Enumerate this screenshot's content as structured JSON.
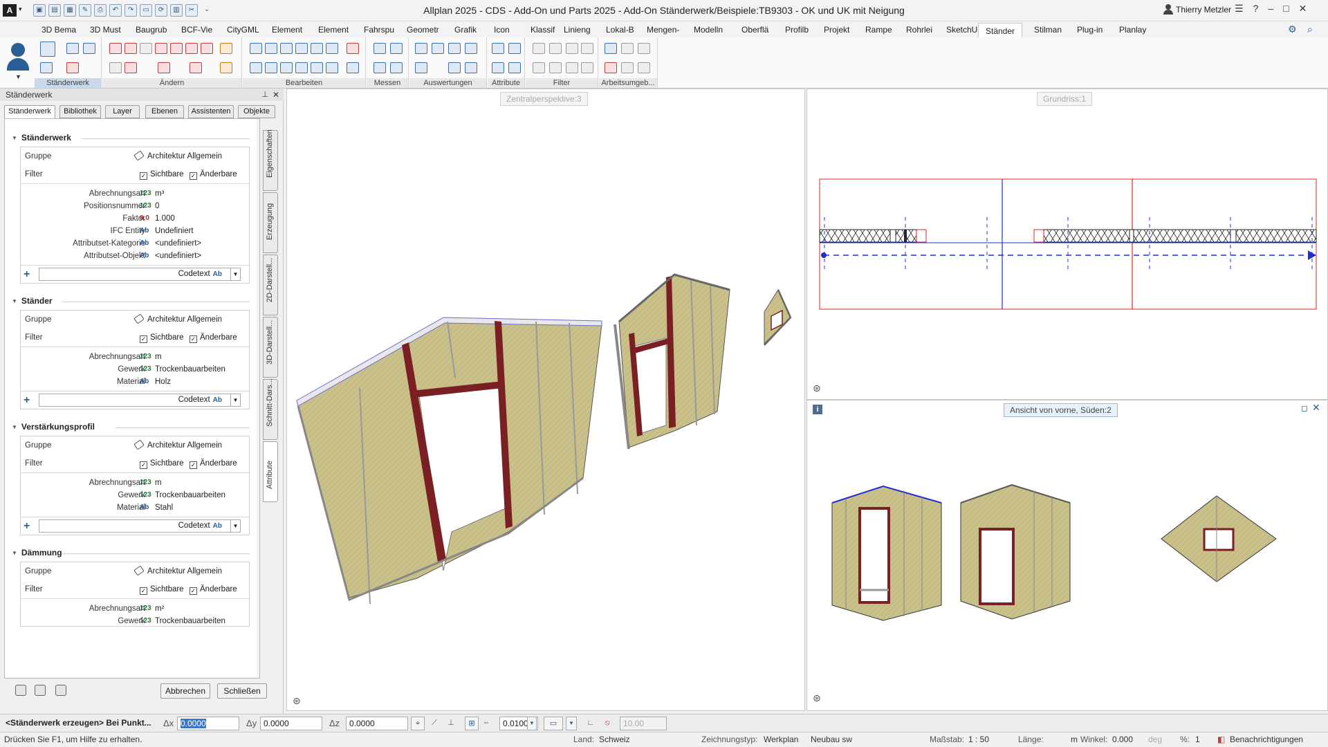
{
  "app": {
    "title": "Allplan 2025 - CDS - Add-On und Parts 2025 - Add-On Ständerwerk/Beispiele:TB9303 - OK und UK mit Neigung",
    "logo": "A",
    "user": "Thierry Metzler"
  },
  "ribbon_tabs": [
    "3D Bema",
    "3D Must",
    "Baugrub",
    "BCF-Vie",
    "CityGML",
    "Element",
    "Element",
    "Fahrspu",
    "Geometr",
    "Grafik",
    "Icon",
    "Klassif",
    "Linieng",
    "Lokal-B",
    "Mengen-",
    "Modelln",
    "Oberflä",
    "Profilb",
    "Projekt",
    "Rampe",
    "Rohrlei",
    "SketchU",
    "Ständer",
    "Stilman",
    "Plug-in",
    "Planlay"
  ],
  "active_tab": "Ständer",
  "ribbon_groups": [
    "Ständerwerk",
    "Ändern",
    "Bearbeiten",
    "Messen",
    "Auswertungen",
    "Attribute",
    "Filter",
    "Arbeitsumgeb..."
  ],
  "panel": {
    "title": "Ständerwerk",
    "tabs": [
      "Ständerwerk",
      "Bibliothek",
      "Layer",
      "Ebenen",
      "Assistenten",
      "Objekte"
    ],
    "vertical_tabs": [
      "Eigenschaften",
      "Erzeugung",
      "2D-Darstell...",
      "3D-Darstell...",
      "Schnitt-Dars...",
      "Attribute"
    ],
    "sections": [
      {
        "name": "Ständerwerk",
        "gruppe": "Architektur Allgemein",
        "filter_label": "Filter",
        "sichtbare": "Sichtbare",
        "aenderbare": "Änderbare",
        "rows": [
          {
            "label": "Abrechnungsart",
            "type": "123",
            "value": "m³"
          },
          {
            "label": "Positionsnummer",
            "type": "123",
            "value": "0"
          },
          {
            "label": "Faktor",
            "type": "0,0",
            "value": "1.000"
          },
          {
            "label": "IFC Entity",
            "type": "Ab",
            "value": "Undefiniert"
          },
          {
            "label": "Attributset-Kategorie",
            "type": "Ab",
            "value": "<undefiniert>"
          },
          {
            "label": "Attributset-Objekt",
            "type": "Ab",
            "value": "<undefiniert>"
          }
        ]
      },
      {
        "name": "Ständer",
        "gruppe": "Architektur Allgemein",
        "filter_label": "Filter",
        "sichtbare": "Sichtbare",
        "aenderbare": "Änderbare",
        "rows": [
          {
            "label": "Abrechnungsart",
            "type": "123",
            "value": "m"
          },
          {
            "label": "Gewerk",
            "type": "123",
            "value": "Trockenbauarbeiten"
          },
          {
            "label": "Material",
            "type": "Ab",
            "value": "Holz"
          }
        ]
      },
      {
        "name": "Verstärkungsprofil",
        "gruppe": "Architektur Allgemein",
        "filter_label": "Filter",
        "sichtbare": "Sichtbare",
        "aenderbare": "Änderbare",
        "rows": [
          {
            "label": "Abrechnungsart",
            "type": "123",
            "value": "m"
          },
          {
            "label": "Gewerk",
            "type": "123",
            "value": "Trockenbauarbeiten"
          },
          {
            "label": "Material",
            "type": "Ab",
            "value": "Stahl"
          }
        ]
      },
      {
        "name": "Dämmung",
        "gruppe": "Architektur Allgemein",
        "filter_label": "Filter",
        "sichtbare": "Sichtbare",
        "aenderbare": "Änderbare",
        "rows": [
          {
            "label": "Abrechnungsart",
            "type": "123",
            "value": "m²"
          },
          {
            "label": "Gewerk",
            "type": "123",
            "value": "Trockenbauarbeiten"
          }
        ]
      }
    ],
    "gruppe_label": "Gruppe",
    "codetext": "Codetext",
    "codetext_type": "Ab",
    "buttons": {
      "cancel": "Abbrechen",
      "close": "Schließen"
    }
  },
  "viewports": {
    "perspective": "Zentralperspektive:3",
    "plan": "Grundriss:1",
    "front": "Ansicht von vorne, Süden:2"
  },
  "input_bar": {
    "command": "<Ständerwerk erzeugen> Bei Punkt...",
    "dx_label": "Δx",
    "dx": "0.0000",
    "dy_label": "Δy",
    "dy": "0.0000",
    "dz_label": "Δz",
    "dz": "0.0000",
    "step": "0.0100",
    "angle_value": "10.00"
  },
  "status": {
    "hint": "Drücken Sie F1, um Hilfe zu erhalten.",
    "land_label": "Land:",
    "land": "Schweiz",
    "type_label": "Zeichnungstyp:",
    "type": "Werkplan",
    "mode": "Neubau sw",
    "scale_label": "Maßstab:",
    "scale": "1 : 50",
    "length_label": "Länge:",
    "length": "m",
    "angle_label": "Winkel:",
    "angle": "0.000",
    "angle_unit": "deg",
    "percent_label": "%:",
    "percent": "1",
    "notifications": "Benachrichtigungen"
  },
  "colors": {
    "accent": "#2a5e96",
    "stud": "#7a1f24",
    "insulation": "#c9c08a",
    "plan_red": "#e02020",
    "plan_blue": "#1f2fd0"
  }
}
